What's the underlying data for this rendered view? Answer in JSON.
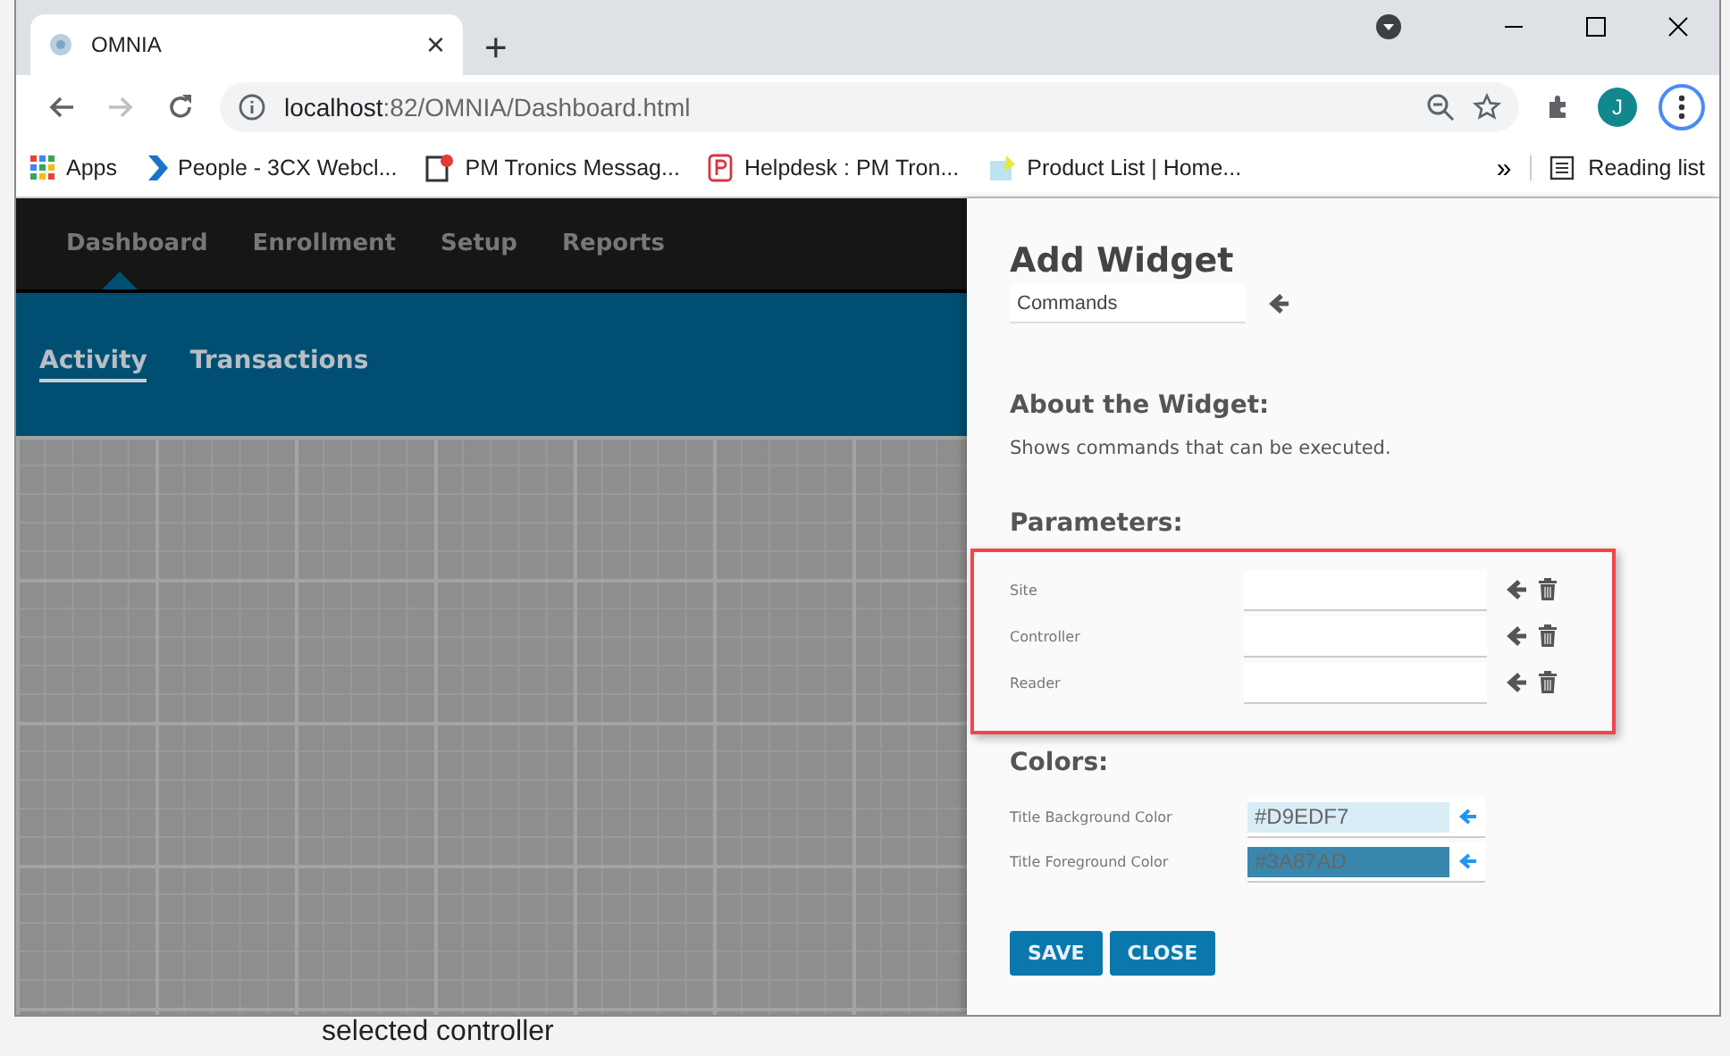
{
  "browser": {
    "tab": {
      "title": "OMNIA",
      "close": "×"
    },
    "new_tab": "+",
    "address": {
      "host": "localhost",
      "path": ":82/OMNIA/Dashboard.html"
    },
    "forward_disabled": true,
    "avatar": "J",
    "bookmarks": [
      {
        "label": "Apps",
        "kind": "apps"
      },
      {
        "label": "People - 3CX Webcl...",
        "kind": "chevron"
      },
      {
        "label": "PM Tronics Messag...",
        "kind": "message"
      },
      {
        "label": "Helpdesk : PM Tron...",
        "kind": "helpdesk"
      },
      {
        "label": "Product List | Home...",
        "kind": "note"
      }
    ],
    "overflow": "»",
    "reading_list": "Reading list"
  },
  "nav": {
    "items": [
      {
        "label": "Dashboard",
        "selected": true
      },
      {
        "label": "Enrollment",
        "selected": false
      },
      {
        "label": "Setup",
        "selected": false
      },
      {
        "label": "Reports",
        "selected": false
      }
    ],
    "subnav": [
      {
        "label": "Activity",
        "selected": true
      },
      {
        "label": "Transactions",
        "selected": false
      }
    ]
  },
  "panel": {
    "title": "Add Widget",
    "widget": "Commands",
    "about_heading": "About the Widget:",
    "description": "Shows commands that can be executed.",
    "parameters_heading": "Parameters:",
    "parameters": [
      {
        "label": "Site"
      },
      {
        "label": "Controller"
      },
      {
        "label": "Reader"
      }
    ],
    "colors_heading": "Colors:",
    "colors": [
      {
        "label": "Title Background Color",
        "value": "#D9EDF7",
        "color": "#d9edf7"
      },
      {
        "label": "Title Foreground Color",
        "value": "#3A87AD",
        "color": "#3a87ad"
      }
    ],
    "buttons": [
      "SAVE",
      "CLOSE"
    ]
  },
  "footer_text": "selected controller"
}
